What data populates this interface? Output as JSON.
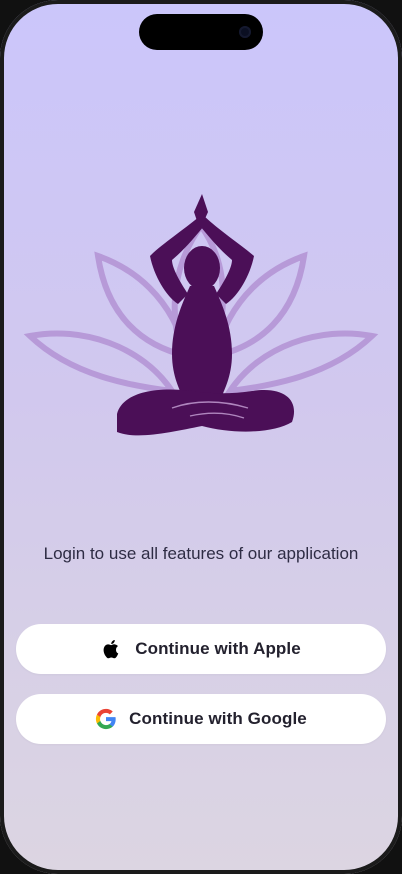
{
  "tagline": "Login to use all features of our application",
  "buttons": {
    "apple": {
      "label": "Continue with Apple",
      "icon": "apple-icon"
    },
    "google": {
      "label": "Continue with Google",
      "icon": "google-icon"
    }
  },
  "logo": {
    "icon": "yoga-lotus-logo"
  },
  "colors": {
    "background_top": "#cbc6fb",
    "background_bottom": "#dcd5e2",
    "figure": "#4b0f57",
    "petals": "#b79ad8",
    "button_bg": "#ffffff",
    "text_dark": "#23212e"
  }
}
